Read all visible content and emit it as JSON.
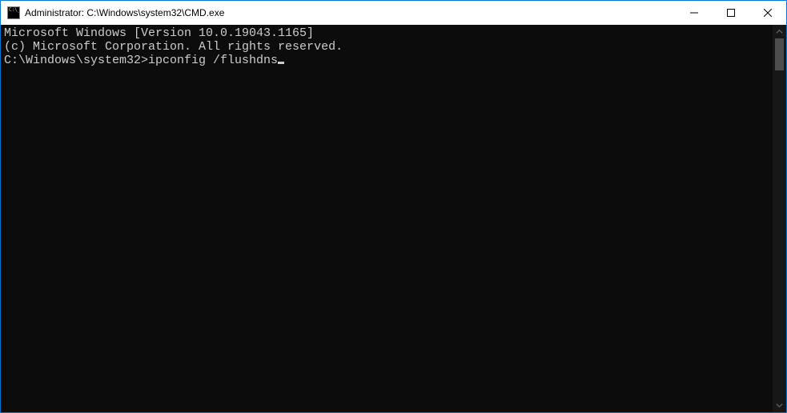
{
  "window": {
    "title": "Administrator: C:\\Windows\\system32\\CMD.exe"
  },
  "terminal": {
    "line1": "Microsoft Windows [Version 10.0.19043.1165]",
    "line2": "(c) Microsoft Corporation. All rights reserved.",
    "blank": "",
    "prompt": "C:\\Windows\\system32>",
    "command": "ipconfig /flushdns"
  }
}
